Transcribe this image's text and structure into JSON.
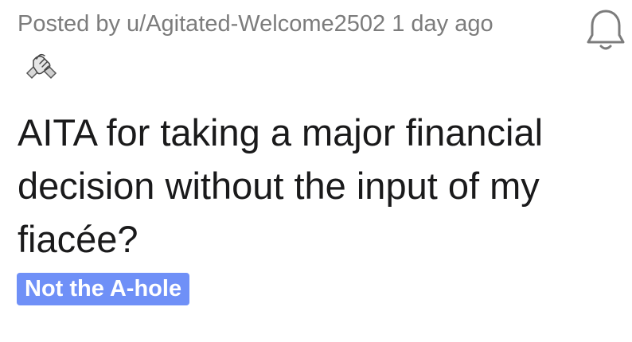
{
  "post": {
    "meta": "Posted by u/Agitated-Welcome2502 1 day ago",
    "title": "AITA for taking a major financial decision without the input of my fiacée?",
    "flair": "Not the A-hole"
  },
  "icons": {
    "notification": "bell-icon",
    "award": "handshake-award-icon"
  },
  "colors": {
    "flair_background": "#6f90f7",
    "meta_text": "#7c7c7c",
    "title_text": "#1a1a1b"
  }
}
